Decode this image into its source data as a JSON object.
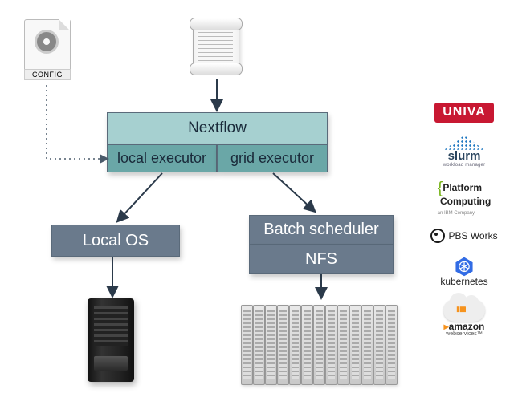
{
  "icons": {
    "config_label": "CONFIG"
  },
  "flow": {
    "nextflow": "Nextflow",
    "local_executor": "local executor",
    "grid_executor": "grid executor",
    "local_os": "Local OS",
    "batch_scheduler": "Batch scheduler",
    "nfs": "NFS"
  },
  "sidebar": {
    "univa": "UNIVA",
    "slurm": "slurm",
    "slurm_sub": "workload manager",
    "platform_l1": "Platform",
    "platform_l2": "Computing",
    "platform_sub": "an IBM Company",
    "pbs": "PBS Works",
    "k8s": "kubernetes",
    "aws": "amazon",
    "aws_sub": "webservices™"
  }
}
